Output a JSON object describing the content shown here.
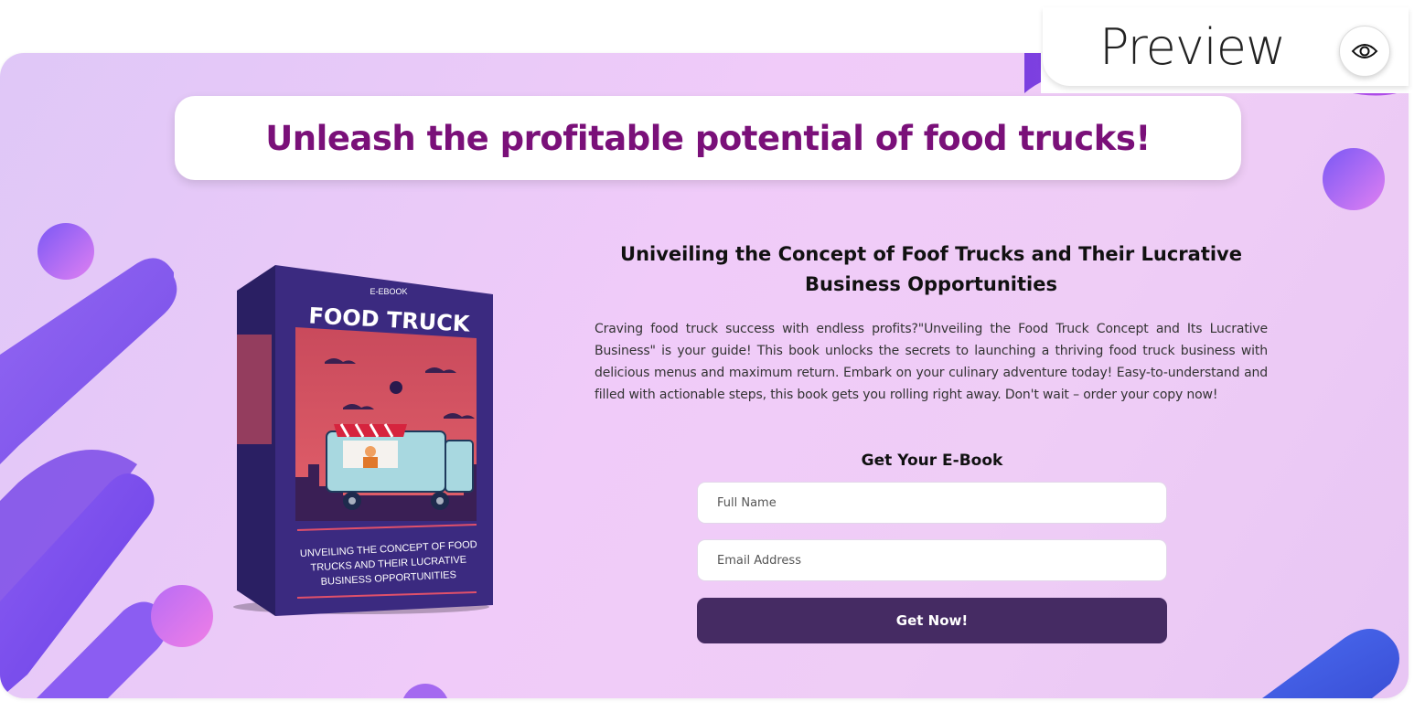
{
  "preview": {
    "label": "Preview",
    "icon": "eye-icon"
  },
  "headline": "Unleash the profitable potential of food trucks!",
  "book": {
    "tag": "E-EBOOK",
    "title": "FOOD TRUCK",
    "subtitle_lines": [
      "UNVEILING THE CONCEPT OF FOOD",
      "TRUCKS AND THEIR LUCRATIVE",
      "BUSINESS OPPORTUNITIES"
    ]
  },
  "content": {
    "title": "Univeiling the Concept of Foof Trucks and Their Lucrative Business Opportunities",
    "description": "Craving food truck success with endless profits?\"Unveiling the Food Truck Concept and Its Lucrative Business\" is your guide! This book unlocks the secrets to launching a thriving food truck business with delicious menus and maximum return. Embark on your culinary adventure today! Easy-to-understand and filled with actionable steps, this book gets you rolling right away. Don't wait – order your copy now!"
  },
  "form": {
    "title": "Get Your E-Book",
    "name_placeholder": "Full Name",
    "email_placeholder": "Email Address",
    "submit_label": "Get Now!"
  },
  "colors": {
    "headline": "#7a1079",
    "button": "#452b63",
    "accent_purple": "#7b4cf0",
    "accent_pink": "#e070f0"
  }
}
